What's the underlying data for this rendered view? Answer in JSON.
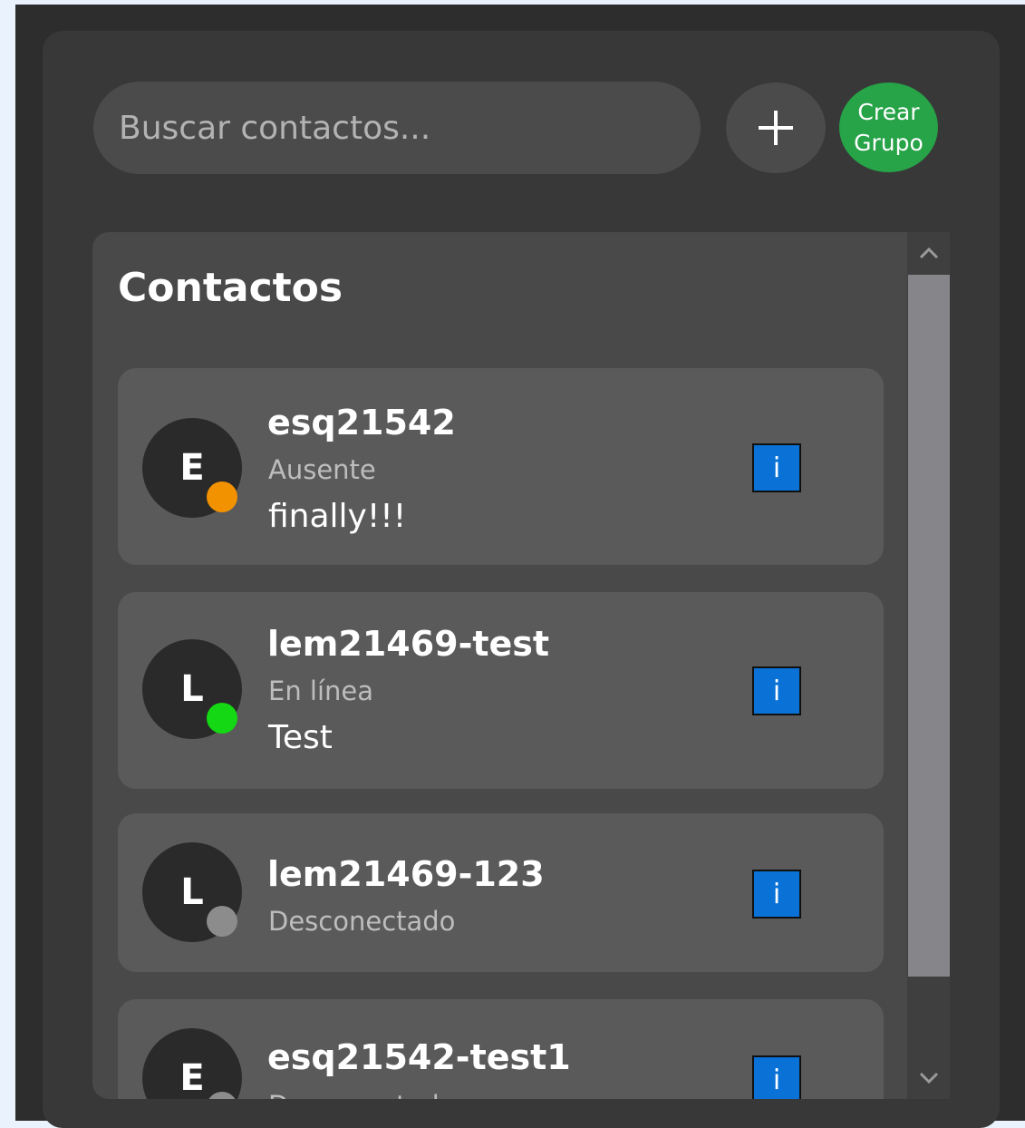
{
  "search": {
    "placeholder": "Buscar contactos..."
  },
  "toolbar": {
    "add_icon": "plus-icon",
    "create_group_line1": "Crear",
    "create_group_line2": "Grupo",
    "create_group_color": "#27a348"
  },
  "contacts": {
    "title": "Contactos",
    "items": [
      {
        "initial": "E",
        "name": "esq21542",
        "status": "Ausente",
        "status_color": "#f39200",
        "message": "finally!!!",
        "info_label": "i"
      },
      {
        "initial": "L",
        "name": "lem21469-test",
        "status": "En línea",
        "status_color": "#14d814",
        "message": "Test",
        "info_label": "i"
      },
      {
        "initial": "L",
        "name": "lem21469-123",
        "status": "Desconectado",
        "status_color": "#8c8c8c",
        "message": "",
        "info_label": "i"
      },
      {
        "initial": "E",
        "name": "esq21542-test1",
        "status": "Desconectado",
        "status_color": "#8c8c8c",
        "message": "",
        "info_label": "i"
      }
    ]
  },
  "scrollbar": {
    "up_icon": "chevron-up-icon",
    "down_icon": "chevron-down-icon"
  }
}
